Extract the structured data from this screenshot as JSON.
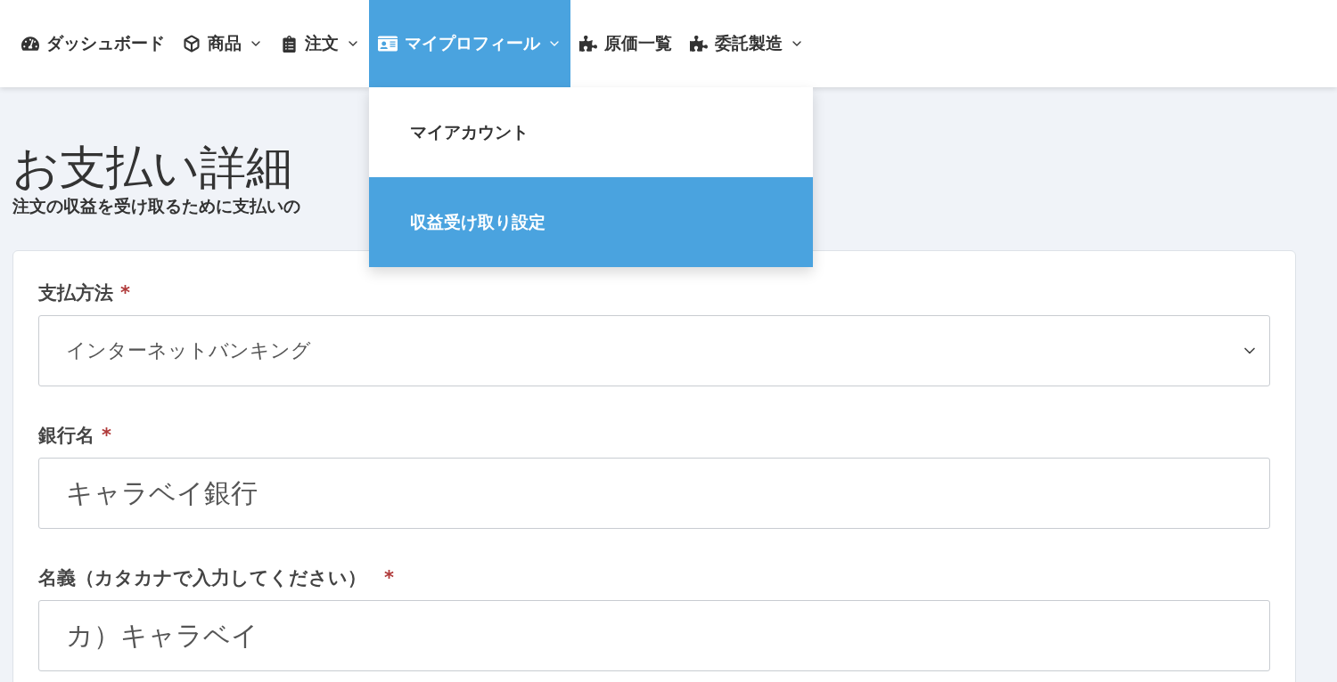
{
  "nav": {
    "items": [
      {
        "label": "ダッシュボード",
        "has_dropdown": false,
        "selected": false
      },
      {
        "label": "商品",
        "has_dropdown": true,
        "selected": false
      },
      {
        "label": "注文",
        "has_dropdown": true,
        "selected": false
      },
      {
        "label": "マイプロフィール",
        "has_dropdown": true,
        "selected": true
      },
      {
        "label": "原価一覧",
        "has_dropdown": false,
        "selected": false
      },
      {
        "label": "委託製造",
        "has_dropdown": true,
        "selected": false
      }
    ]
  },
  "dropdown": {
    "items": [
      {
        "label": "マイアカウント",
        "selected": false
      },
      {
        "label": "収益受け取り設定",
        "selected": true
      }
    ]
  },
  "page": {
    "title": "お支払い詳細",
    "subtitle": "注文の収益を受け取るために支払いの"
  },
  "form": {
    "fields": [
      {
        "kind": "select",
        "label": "支払方法",
        "required_mark": "*",
        "value": "インターネットバンキング"
      },
      {
        "kind": "input",
        "label": "銀行名",
        "required_mark": "*",
        "value": "キャラベイ銀行"
      },
      {
        "kind": "input",
        "label": "名義（カタカナで入力してください）",
        "required_mark": "*",
        "value": "カ）キャラベイ"
      }
    ]
  }
}
